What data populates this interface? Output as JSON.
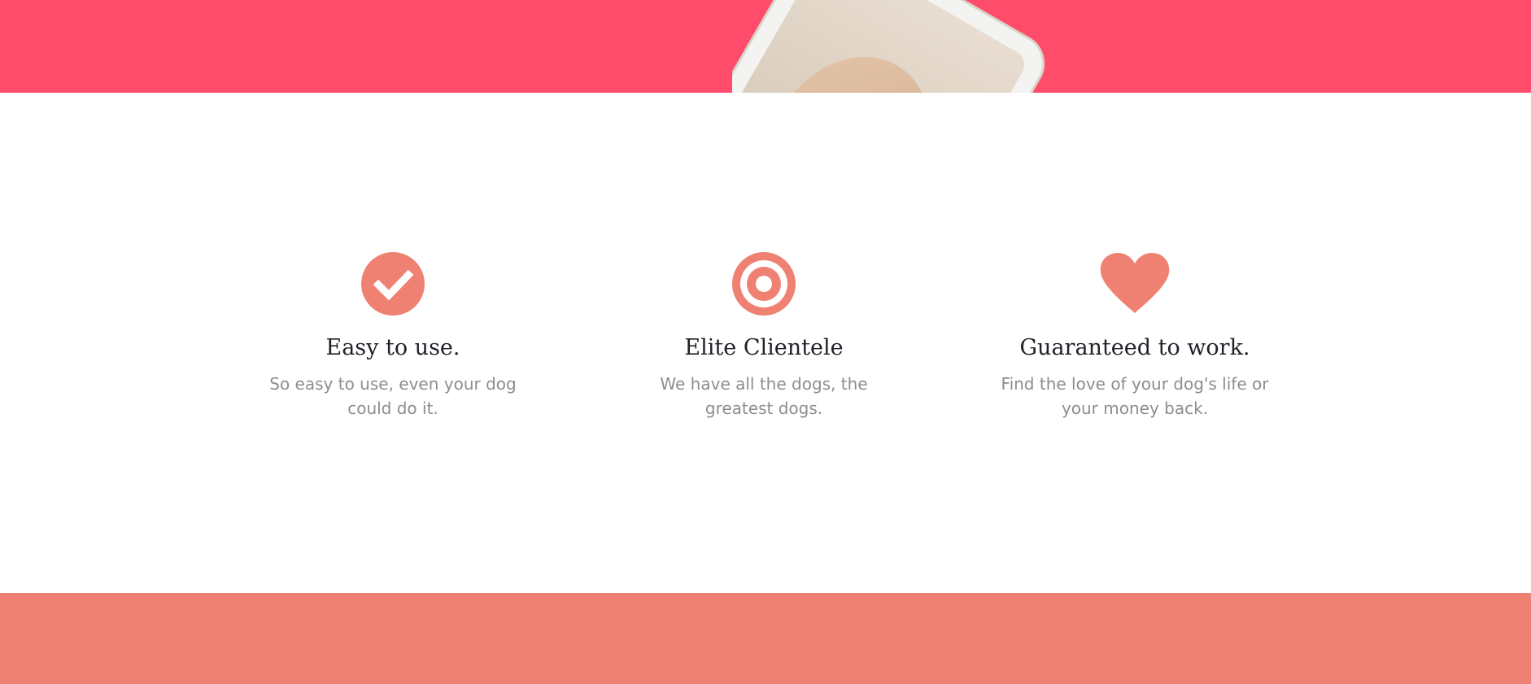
{
  "colors": {
    "hero_band": "#FF4C6A",
    "accent": "#EF8172",
    "bottom_band": "#EF8172",
    "heading_text": "#1F2228",
    "body_text": "#8B8D91",
    "page_bg": "#FFFFFF"
  },
  "hero": {
    "image": "phone-with-dog-photo"
  },
  "features": [
    {
      "icon": "check-circle-icon",
      "title": "Easy to use.",
      "description": "So easy to use, even your dog could do it."
    },
    {
      "icon": "target-icon",
      "title": "Elite Clientele",
      "description": "We have all the dogs, the greatest dogs."
    },
    {
      "icon": "heart-icon",
      "title": "Guaranteed to work.",
      "description": "Find the love of your dog's life or your money back."
    }
  ]
}
